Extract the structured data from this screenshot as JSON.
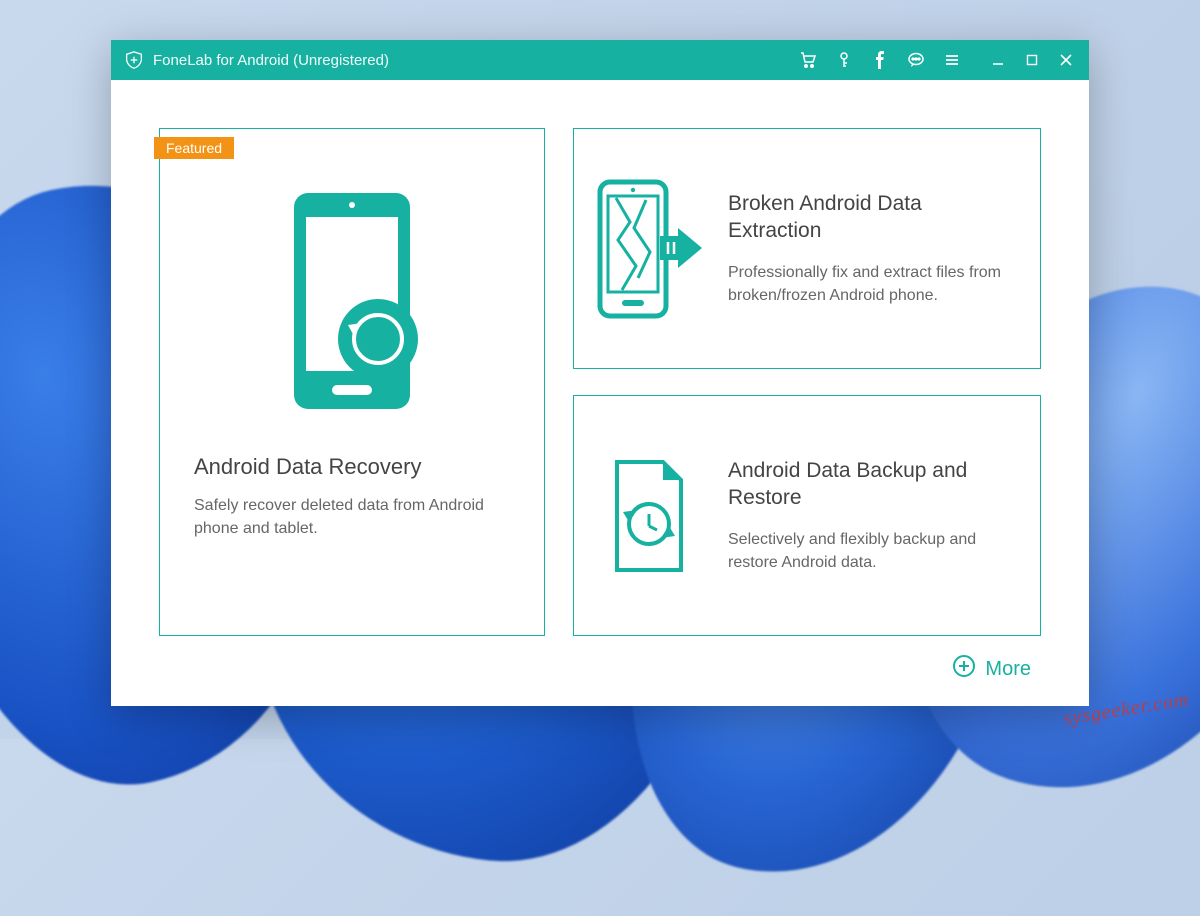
{
  "colors": {
    "accent": "#17b1a1",
    "featured_badge": "#f39316"
  },
  "titlebar": {
    "app_title": "FoneLab for Android (Unregistered)"
  },
  "cards": {
    "featured_badge": "Featured",
    "main": {
      "title": "Android Data Recovery",
      "description": "Safely recover deleted data from Android phone and tablet."
    },
    "extraction": {
      "title": "Broken Android Data Extraction",
      "description": "Professionally fix and extract files from broken/frozen Android phone."
    },
    "backup": {
      "title": "Android Data Backup and Restore",
      "description": "Selectively and flexibly backup and restore Android data."
    }
  },
  "more_button": "More",
  "watermark": "sysgeeker.com"
}
